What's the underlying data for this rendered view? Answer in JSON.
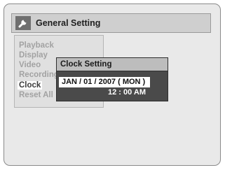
{
  "window": {
    "title": "General Setting",
    "icon": "wrench-icon"
  },
  "menu": {
    "items": [
      {
        "label": "Playback",
        "selected": false
      },
      {
        "label": "Display",
        "selected": false
      },
      {
        "label": "Video",
        "selected": false
      },
      {
        "label": "Recording",
        "selected": false
      },
      {
        "label": "Clock",
        "selected": true
      },
      {
        "label": "Reset All",
        "selected": false
      }
    ]
  },
  "clock_popup": {
    "title": "Clock Setting",
    "date": "JAN / 01 / 2007 ( MON )",
    "time": "12 : 00 AM"
  },
  "colors": {
    "screen_bg": "#e9e9e9",
    "header_bg": "#cfcfcf",
    "popup_bg": "#4a4a4a",
    "highlight": "#ffffff",
    "dim_text": "#a2a2a2"
  }
}
